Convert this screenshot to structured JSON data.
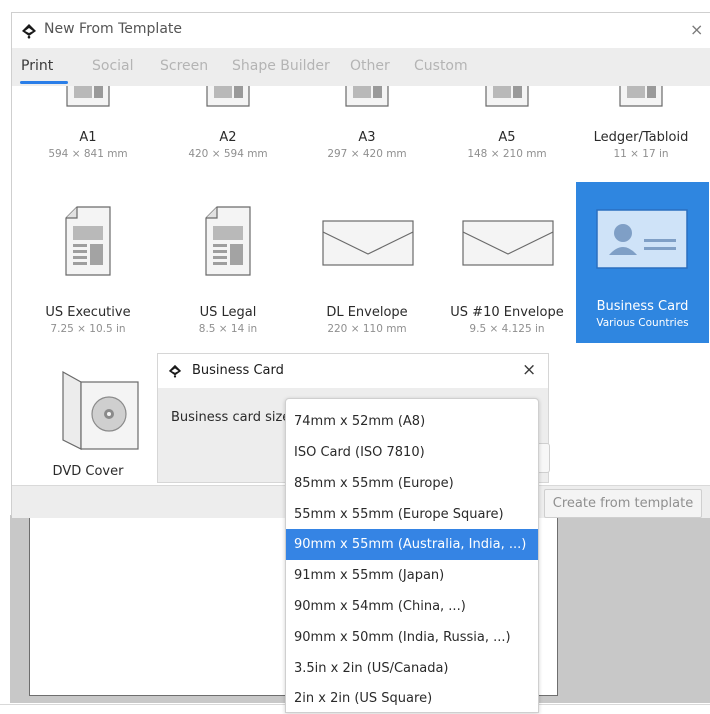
{
  "window": {
    "title": "New From Template",
    "close_glyph": "×"
  },
  "tabs": [
    {
      "label": "Print",
      "active": true
    },
    {
      "label": "Social",
      "active": false
    },
    {
      "label": "Screen",
      "active": false
    },
    {
      "label": "Shape Builder",
      "active": false
    },
    {
      "label": "Other",
      "active": false
    },
    {
      "label": "Custom",
      "active": false
    }
  ],
  "templates_row1": [
    {
      "name": "A1",
      "size": "594 × 841 mm"
    },
    {
      "name": "A2",
      "size": "420 × 594 mm"
    },
    {
      "name": "A3",
      "size": "297 × 420 mm"
    },
    {
      "name": "A5",
      "size": "148 × 210 mm"
    },
    {
      "name": "Ledger/Tabloid",
      "size": "11 × 17 in"
    }
  ],
  "templates_row2": [
    {
      "name": "US Executive",
      "size": "7.25 × 10.5 in",
      "icon": "document-icon"
    },
    {
      "name": "US Legal",
      "size": "8.5 × 14 in",
      "icon": "document-icon"
    },
    {
      "name": "DL Envelope",
      "size": "220 × 110 mm",
      "icon": "envelope-icon"
    },
    {
      "name": "US #10 Envelope",
      "size": "9.5 × 4.125 in",
      "icon": "envelope-icon"
    },
    {
      "name": "Business Card",
      "size": "Various Countries",
      "icon": "business-card-icon",
      "selected": true
    }
  ],
  "templates_row3": [
    {
      "name": "DVD Cover",
      "icon": "dvd-cover-icon"
    }
  ],
  "footer": {
    "create_label": "Create from template"
  },
  "subdialog": {
    "title": "Business Card",
    "close_glyph": "×",
    "size_label": "Business card size:"
  },
  "dropdown": {
    "options": [
      "74mm x 52mm (A8)",
      "ISO Card (ISO 7810)",
      "85mm x 55mm (Europe)",
      "55mm x 55mm (Europe Square)",
      "90mm x 55mm (Australia, India, ...)",
      "91mm x 55mm (Japan)",
      "90mm x 54mm (China, ...)",
      "90mm x 50mm (India, Russia, ...)",
      "3.5in x 2in (US/Canada)",
      "2in x 2in (US Square)"
    ],
    "selected": "90mm x 55mm (Australia, India, ...)"
  },
  "colors": {
    "accent": "#3584e4",
    "selected_tile": "#2f86e0",
    "tab_underline": "#2a7ee8"
  }
}
